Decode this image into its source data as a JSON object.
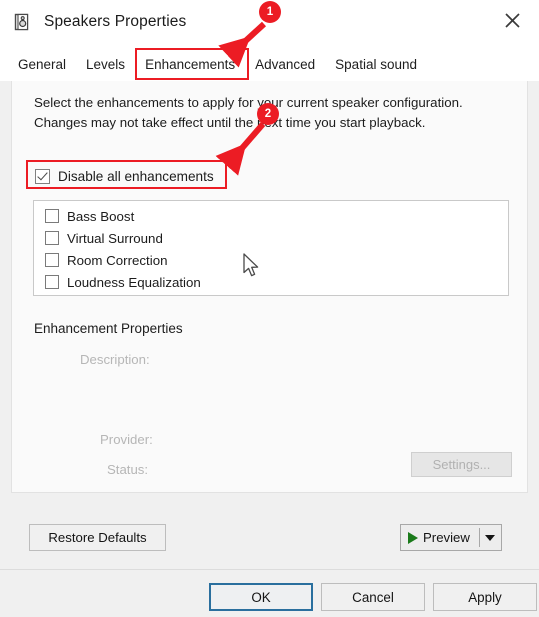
{
  "window": {
    "title": "Speakers Properties",
    "icon": "speaker-icon",
    "close_icon": "close-icon"
  },
  "tabs": [
    {
      "label": "General",
      "selected": false
    },
    {
      "label": "Levels",
      "selected": false
    },
    {
      "label": "Enhancements",
      "selected": true
    },
    {
      "label": "Advanced",
      "selected": false
    },
    {
      "label": "Spatial sound",
      "selected": false
    }
  ],
  "main": {
    "intro_text": "Select the enhancements to apply for your current speaker configuration. Changes may not take effect until the next time you start playback.",
    "disable_all": {
      "label": "Disable all enhancements",
      "checked": true
    },
    "enhancements": [
      {
        "label": "Bass Boost",
        "checked": false
      },
      {
        "label": "Virtual Surround",
        "checked": false
      },
      {
        "label": "Room Correction",
        "checked": false
      },
      {
        "label": "Loudness Equalization",
        "checked": false
      }
    ],
    "properties": {
      "heading": "Enhancement Properties",
      "description_label": "Description:",
      "description_value": "",
      "provider_label": "Provider:",
      "provider_value": "",
      "status_label": "Status:",
      "status_value": "",
      "settings_button": "Settings..."
    },
    "restore_defaults_button": "Restore Defaults",
    "preview": {
      "label": "Preview",
      "play_icon": "play-icon",
      "dropdown_icon": "chevron-down-icon"
    }
  },
  "footer": {
    "ok": "OK",
    "cancel": "Cancel",
    "apply": "Apply"
  },
  "annotations": {
    "badge_1": "1",
    "badge_2": "2",
    "highlight_color": "#ec1c24"
  }
}
